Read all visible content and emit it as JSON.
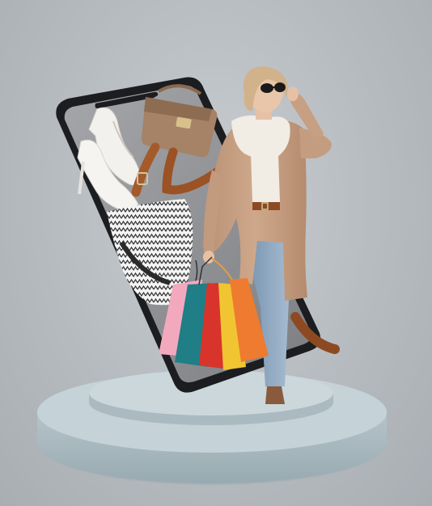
{
  "scene": {
    "description_free": true,
    "colors": {
      "background": "#b9bec2",
      "pedestal_top": "#c3d0d5",
      "pedestal_side": "#a9b9bf",
      "phone_frame": "#1c1d20",
      "phone_screen": "#8f9093",
      "coat": "#c7a184",
      "jeans": "#8aa3bd",
      "scarf": "#f1ece4",
      "bag_pink": "#f2a9be",
      "bag_teal": "#1f7e86",
      "bag_red": "#d9342b",
      "bag_yellow": "#f1c531",
      "bag_orange": "#ee7b2f",
      "handbag": "#9c7a5d",
      "belt": "#8d4a22"
    },
    "icons": [
      "smartphone",
      "pedestal",
      "shopping-bags",
      "high-heels",
      "handbag",
      "belt",
      "woman-shopper"
    ]
  }
}
